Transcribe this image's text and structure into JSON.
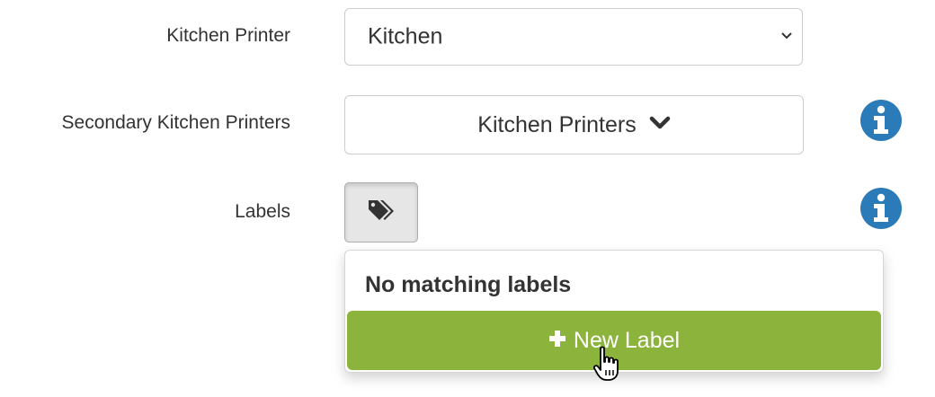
{
  "form": {
    "kitchen_printer": {
      "label": "Kitchen Printer",
      "selected": "Kitchen"
    },
    "secondary_printers": {
      "label": "Secondary Kitchen Printers",
      "button_text": "Kitchen Printers"
    },
    "labels": {
      "label": "Labels"
    }
  },
  "dropdown": {
    "empty_message": "No matching labels",
    "new_label_button": "New Label"
  },
  "colors": {
    "accent_green": "#8cb33c",
    "info_blue": "#2b7bb9"
  },
  "icons": {
    "select_chevron": "chevron-down-icon",
    "multi_chevron": "chevron-down-icon",
    "info": "info-circle-icon",
    "tags": "tags-icon",
    "plus": "plus-icon",
    "cursor": "hand-pointer-icon"
  }
}
